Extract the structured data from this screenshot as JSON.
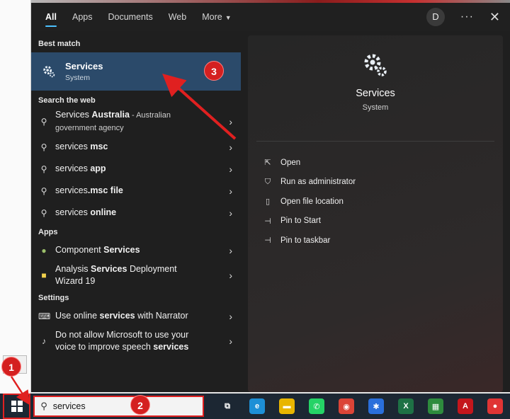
{
  "tabs": [
    {
      "label": "All",
      "active": true
    },
    {
      "label": "Apps",
      "active": false
    },
    {
      "label": "Documents",
      "active": false
    },
    {
      "label": "Web",
      "active": false
    },
    {
      "label": "More",
      "active": false
    }
  ],
  "header": {
    "avatar": "D",
    "more_icon": "ellipsis-icon",
    "close_icon": "close-icon"
  },
  "left": {
    "best_match_title": "Best match",
    "best_match": {
      "name": "Services",
      "type": "System",
      "icon": "gear-icon"
    },
    "web_title": "Search the web",
    "web_items": [
      {
        "pre": "Services ",
        "bold": "Australia",
        "post": " - Australian",
        "sub": "government agency"
      },
      {
        "pre": "services ",
        "bold": "msc",
        "post": ""
      },
      {
        "pre": "services ",
        "bold": "app",
        "post": ""
      },
      {
        "pre": "services",
        "bold": ".msc file",
        "post": ""
      },
      {
        "pre": "services ",
        "bold": "online",
        "post": ""
      }
    ],
    "apps_title": "Apps",
    "app_items": [
      {
        "pre": "Component ",
        "bold": "Services",
        "post": "",
        "line2": ""
      },
      {
        "pre": "Analysis ",
        "bold": "Services",
        "post": " Deployment",
        "line2": "Wizard 19"
      }
    ],
    "settings_title": "Settings",
    "settings_items": [
      {
        "pre": "Use online ",
        "bold": "services",
        "post": " with Narrator",
        "line2pre": "",
        "line2bold": ""
      },
      {
        "pre": "Do not allow Microsoft to use your",
        "bold": "",
        "post": "",
        "line2pre": "voice to improve speech ",
        "line2bold": "services"
      }
    ]
  },
  "preview": {
    "name": "Services",
    "type": "System",
    "actions": [
      {
        "label": "Open",
        "icon": "open-icon"
      },
      {
        "label": "Run as administrator",
        "icon": "shield-icon"
      },
      {
        "label": "Open file location",
        "icon": "folder-icon"
      },
      {
        "label": "Pin to Start",
        "icon": "pin-icon"
      },
      {
        "label": "Pin to taskbar",
        "icon": "pin-icon"
      }
    ]
  },
  "taskbar": {
    "search_value": "services",
    "icons": [
      {
        "name": "task-view-icon",
        "glyph": "⧉",
        "color": "#1c2733"
      },
      {
        "name": "edge-icon",
        "glyph": "e",
        "color": "#1d8fd6"
      },
      {
        "name": "file-explorer-icon",
        "glyph": "▬",
        "color": "#e8b500"
      },
      {
        "name": "whatsapp-icon",
        "glyph": "✆",
        "color": "#25d366"
      },
      {
        "name": "chrome-icon",
        "glyph": "◉",
        "color": "#db4437"
      },
      {
        "name": "settings-app-icon",
        "glyph": "✱",
        "color": "#2a6fdb"
      },
      {
        "name": "excel-icon",
        "glyph": "X",
        "color": "#1e7145"
      },
      {
        "name": "spreadsheet-icon",
        "glyph": "▦",
        "color": "#2e8b3d"
      },
      {
        "name": "acrobat-icon",
        "glyph": "A",
        "color": "#c4161c"
      },
      {
        "name": "recorder-icon",
        "glyph": "●",
        "color": "#e03434"
      }
    ]
  },
  "annotations": {
    "badge1": "1",
    "badge2": "2",
    "badge3": "3",
    "accent": "#d42020"
  }
}
